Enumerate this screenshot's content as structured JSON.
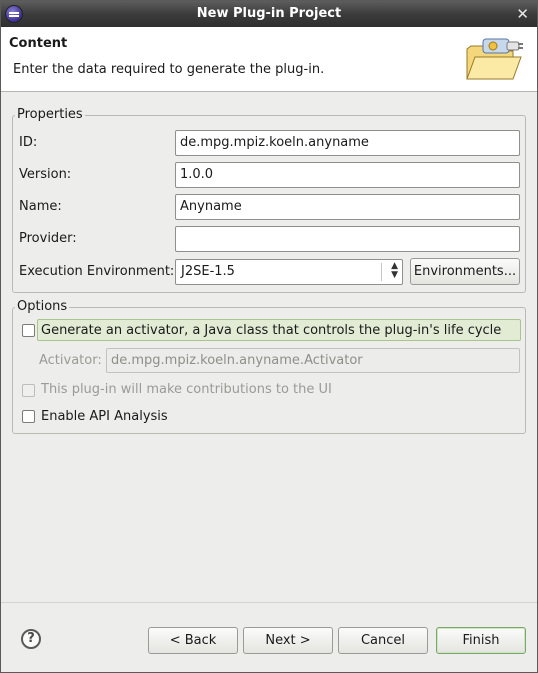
{
  "window": {
    "title": "New Plug-in Project",
    "close_glyph": "✕"
  },
  "header": {
    "title": "Content",
    "description": "Enter the data required to generate the plug-in.",
    "banner_icon": "plugin-wizard-folder-icon"
  },
  "properties": {
    "group_label": "Properties",
    "id_label": "ID:",
    "id_value": "de.mpg.mpiz.koeln.anyname",
    "version_label": "Version:",
    "version_value": "1.0.0",
    "name_label": "Name:",
    "name_value": "Anyname",
    "provider_label": "Provider:",
    "provider_value": "",
    "env_label": "Execution Environment:",
    "env_value": "J2SE-1.5",
    "env_button": "Environments..."
  },
  "options": {
    "group_label": "Options",
    "activator_checkbox": "Generate an activator, a Java class that controls the plug-in's life cycle",
    "activator_label": "Activator:",
    "activator_value": "de.mpg.mpiz.koeln.anyname.Activator",
    "ui_checkbox": "This plug-in will make contributions to the UI",
    "api_checkbox": "Enable API Analysis"
  },
  "footer": {
    "help_glyph": "?",
    "back": "< Back",
    "next": "Next >",
    "cancel": "Cancel",
    "finish": "Finish"
  }
}
